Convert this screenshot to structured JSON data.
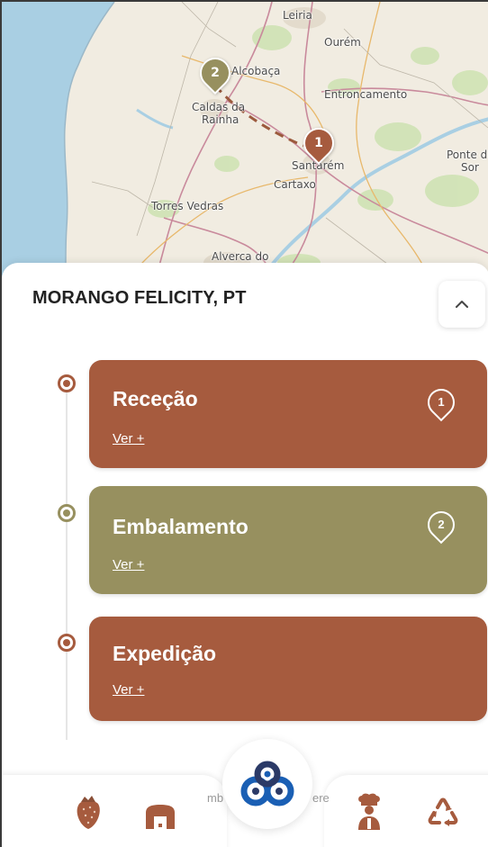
{
  "map": {
    "places": {
      "leiria": "Leiria",
      "ourem": "Ourém",
      "alcobaca": "Alcobaça",
      "caldas_line1": "Caldas da",
      "caldas_line2": "Rainha",
      "entroncamento": "Entroncamento",
      "santarem": "Santarém",
      "ponte_line1": "Ponte d",
      "ponte_line2": "Sor",
      "cartaxo": "Cartaxo",
      "torres_vedras": "Torres Vedras",
      "alverca": "Alverca do"
    },
    "pins": [
      {
        "label": "1",
        "color": "#a65b3e"
      },
      {
        "label": "2",
        "color": "#97905f"
      }
    ]
  },
  "sheet": {
    "title": "MORANGO FELICITY, PT",
    "collapse_icon": "chevron-up-icon"
  },
  "steps": [
    {
      "title": "Receção",
      "link": "Ver +",
      "badge": "1",
      "color": "#a65b3e"
    },
    {
      "title": "Embalamento",
      "link": "Ver +",
      "badge": "2",
      "color": "#97905f"
    },
    {
      "title": "Expedição",
      "link": "Ver +",
      "badge": "",
      "color": "#a65b3e"
    }
  ],
  "colors": {
    "primary": "#a65b3e",
    "secondary": "#97905f",
    "timeline_dot": "#a65b3e",
    "logo_blue": "#1a5fb4",
    "logo_dark": "#2b3a67"
  },
  "nav": {
    "left_hidden_text": "mb",
    "right_hidden_text": "ere",
    "icons": [
      "strawberry-icon",
      "warehouse-icon",
      "logo-icon",
      "chef-icon",
      "recycle-icon"
    ]
  }
}
